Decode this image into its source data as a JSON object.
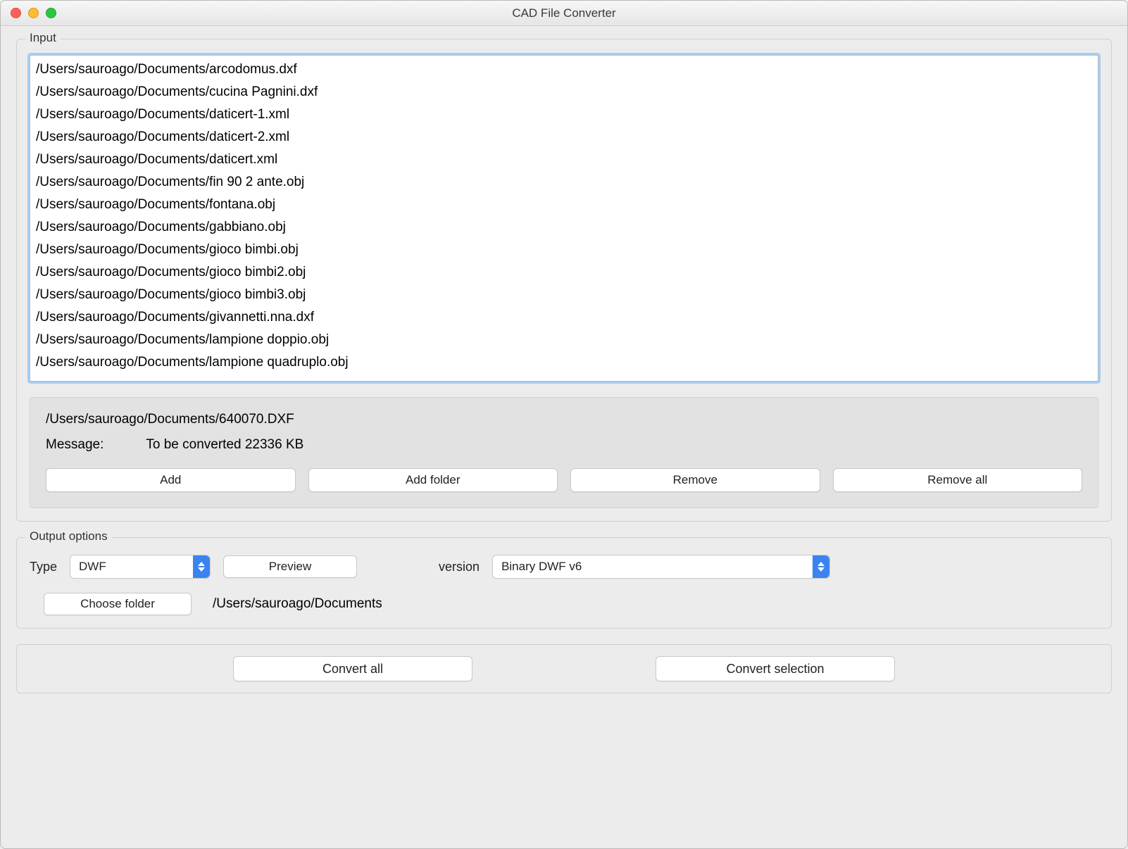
{
  "window": {
    "title": "CAD File Converter"
  },
  "input": {
    "legend": "Input",
    "files": [
      "/Users/sauroago/Documents/arcodomus.dxf",
      "/Users/sauroago/Documents/cucina Pagnini.dxf",
      "/Users/sauroago/Documents/daticert-1.xml",
      "/Users/sauroago/Documents/daticert-2.xml",
      "/Users/sauroago/Documents/daticert.xml",
      "/Users/sauroago/Documents/fin 90 2 ante.obj",
      "/Users/sauroago/Documents/fontana.obj",
      "/Users/sauroago/Documents/gabbiano.obj",
      "/Users/sauroago/Documents/gioco bimbi.obj",
      "/Users/sauroago/Documents/gioco bimbi2.obj",
      "/Users/sauroago/Documents/gioco bimbi3.obj",
      "/Users/sauroago/Documents/givannetti.nna.dxf",
      "/Users/sauroago/Documents/lampione doppio.obj",
      "/Users/sauroago/Documents/lampione quadruplo.obj"
    ],
    "selected_path": "/Users/sauroago/Documents/640070.DXF",
    "message_label": "Message:",
    "message_value": "To be converted 22336 KB",
    "buttons": {
      "add": "Add",
      "add_folder": "Add folder",
      "remove": "Remove",
      "remove_all": "Remove all"
    }
  },
  "output": {
    "legend": "Output options",
    "type_label": "Type",
    "type_value": "DWF",
    "preview": "Preview",
    "version_label": "version",
    "version_value": "Binary DWF v6",
    "choose_folder": "Choose folder",
    "folder_path": "/Users/sauroago/Documents"
  },
  "actions": {
    "convert_all": "Convert all",
    "convert_selection": "Convert selection"
  }
}
